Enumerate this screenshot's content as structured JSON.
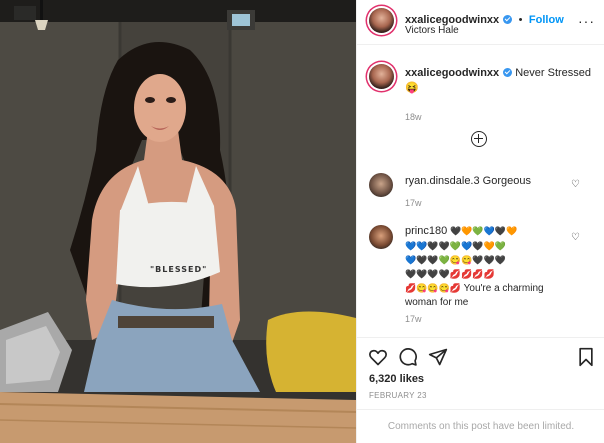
{
  "post": {
    "username": "xxalicegoodwinxx",
    "follow_label": "Follow",
    "follow_sep": "•",
    "location": "Victors Hale",
    "caption_text": "Never Stressed",
    "caption_emoji": "😝",
    "caption_time": "18w"
  },
  "comments": [
    {
      "username": "ryan.dinsdale.3",
      "text": "Gorgeous",
      "time": "17w"
    },
    {
      "username": "princ180",
      "emoji_line1": "🖤🧡💚💙🖤🧡",
      "emoji_line2": "💙💙🖤🖤💚💙🖤🧡💚",
      "emoji_line3": "💙🖤🖤💚😋😋🖤🖤🖤",
      "emoji_line4": "🖤🖤🖤🖤💋💋💋💋",
      "emoji_line5": "💋😋😋😋💋",
      "text": "You're a charming woman for me",
      "time": "17w"
    }
  ],
  "footer": {
    "likes": "6,320 likes",
    "date": "FEBRUARY 23",
    "limited_notice": "Comments on this post have been limited."
  },
  "photo": {
    "print_text": "\"BLESSED\""
  }
}
